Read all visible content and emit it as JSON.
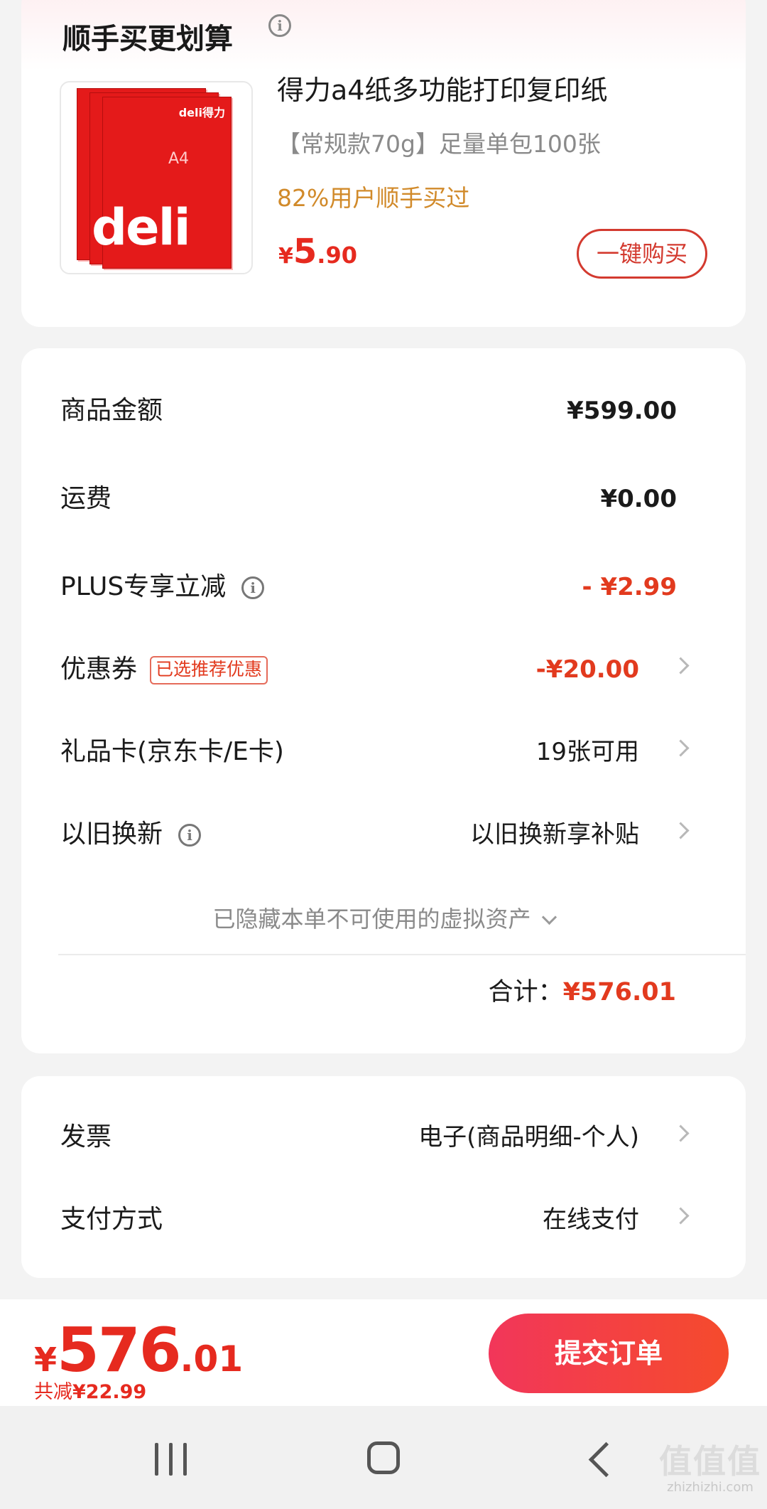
{
  "recommend": {
    "title": "顺手买更划算",
    "product": {
      "image_brand": "deli得力",
      "image_text": "A4",
      "image_big": "deli",
      "name": "得力a4纸多功能打印复印纸",
      "spec": "【常规款70g】足量单包100张",
      "stat": "82%用户顺手买过",
      "price_currency": "¥",
      "price_int": "5",
      "price_dec": ".90",
      "buy_label": "一键购买"
    }
  },
  "summary": {
    "rows": [
      {
        "label": "商品金额",
        "value": "¥599.00"
      },
      {
        "label": "运费",
        "value": "¥0.00"
      },
      {
        "label": "PLUS专享立减",
        "value": "- ¥2.99"
      },
      {
        "label": "优惠券",
        "tag": "已选推荐优惠",
        "value": "-¥20.00"
      },
      {
        "label": "礼品卡(京东卡/E卡)",
        "value": "19张可用"
      },
      {
        "label": "以旧换新",
        "value": "以旧换新享补贴"
      }
    ],
    "hidden_note": "已隐藏本单不可使用的虚拟资产",
    "total_label": "合计：",
    "total_value": "¥576.01"
  },
  "extra": {
    "rows": [
      {
        "label": "发票",
        "value": "电子(商品明细-个人)"
      },
      {
        "label": "支付方式",
        "value": "在线支付"
      }
    ]
  },
  "bottom": {
    "currency": "¥",
    "price_int": "576",
    "price_dec": ".01",
    "save_label": "共减",
    "save_value": "¥22.99",
    "submit_label": "提交订单"
  },
  "watermark": {
    "text": "值值值",
    "domain": "zhizhizhi.com"
  },
  "colors": {
    "accent_red": "#e23a1e",
    "submit_gradient_start": "#f2365a",
    "submit_gradient_end": "#f54b2c",
    "stat_orange": "#d18a2a"
  }
}
